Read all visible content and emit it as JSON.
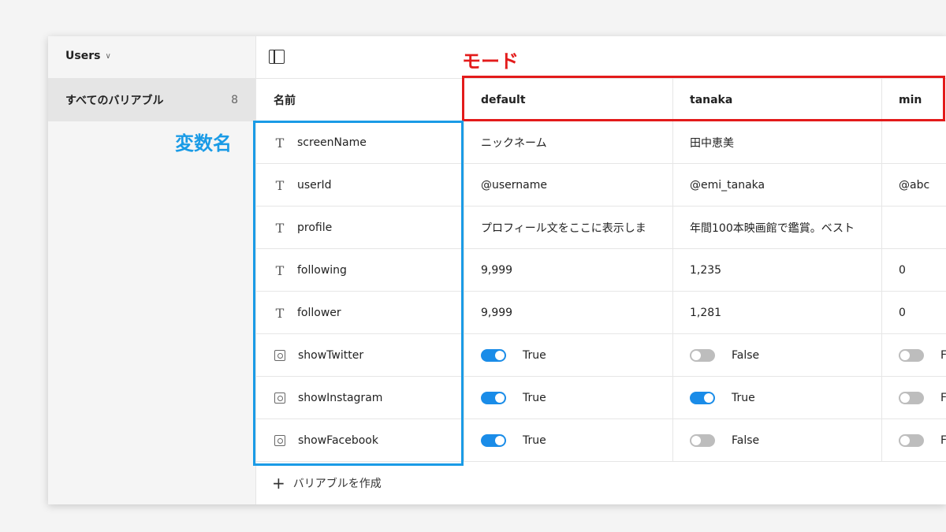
{
  "sidebar": {
    "collection_name": "Users",
    "item_label": "すべてのバリアブル",
    "item_count": "8"
  },
  "table": {
    "headers": [
      "名前",
      "default",
      "tanaka",
      "min"
    ],
    "rows": [
      {
        "name": "screenName",
        "type": "text",
        "values": [
          "ニックネーム",
          "田中恵美",
          ""
        ]
      },
      {
        "name": "userId",
        "type": "text",
        "values": [
          "@username",
          "@emi_tanaka",
          "@abc"
        ]
      },
      {
        "name": "profile",
        "type": "text",
        "values": [
          "プロフィール文をここに表示しま",
          "年間100本映画館で鑑賞。ベスト",
          ""
        ]
      },
      {
        "name": "following",
        "type": "text",
        "values": [
          "9,999",
          "1,235",
          "0"
        ]
      },
      {
        "name": "follower",
        "type": "text",
        "values": [
          "9,999",
          "1,281",
          "0"
        ]
      },
      {
        "name": "showTwitter",
        "type": "boolean",
        "values": [
          true,
          false,
          false
        ]
      },
      {
        "name": "showInstagram",
        "type": "boolean",
        "values": [
          true,
          true,
          false
        ]
      },
      {
        "name": "showFacebook",
        "type": "boolean",
        "values": [
          true,
          false,
          false
        ]
      }
    ]
  },
  "labels": {
    "true": "True",
    "false": "False"
  },
  "add_variable_label": "バリアブルを作成",
  "annotations": {
    "mode_label": "モード",
    "variable_name_label": "変数名",
    "mode_color": "#e31b1b",
    "variable_color": "#1a9be6"
  },
  "colors": {
    "switch_on": "#1a8ce8",
    "switch_off": "#bdbdbd"
  }
}
